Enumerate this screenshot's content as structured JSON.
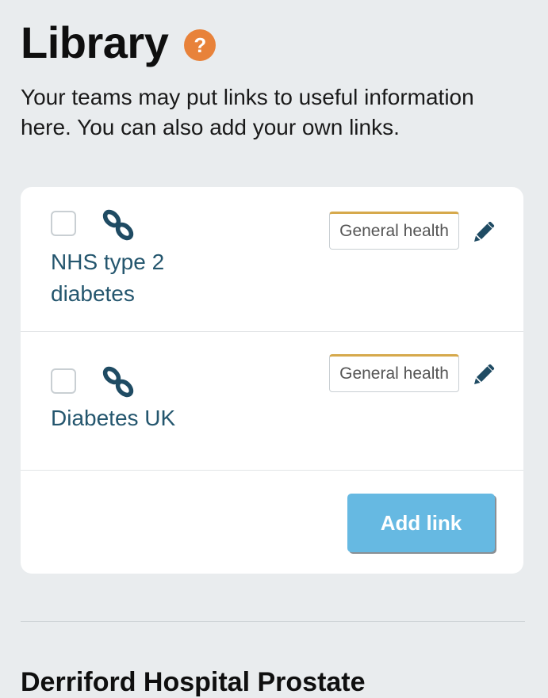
{
  "header": {
    "title": "Library",
    "help_icon": "question-circle-icon",
    "help_symbol": "?"
  },
  "intro": "Your teams may put links to useful information here. You can also add your own links.",
  "links": [
    {
      "title": "NHS type 2 diabetes",
      "tag": "General health",
      "icon": "chain-link-icon",
      "checked": false
    },
    {
      "title": "Diabetes UK",
      "tag": "General health",
      "icon": "chain-link-icon",
      "checked": false
    }
  ],
  "add_link_label": "Add link",
  "next_section_title": "Derriford Hospital Prostate",
  "colors": {
    "background": "#e9ecee",
    "help_icon": "#e8823a",
    "link_text": "#24566e",
    "tag_accent": "#d6a94c",
    "button": "#66b9e2"
  }
}
